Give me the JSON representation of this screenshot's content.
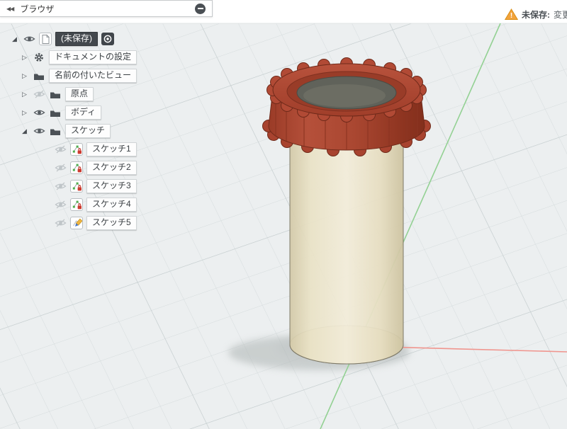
{
  "panel": {
    "title": "ブラウザ"
  },
  "icons": {
    "collapse": "◀◀",
    "expanded": "◢",
    "collapsed": "▷",
    "warning_mark": "!"
  },
  "tree": {
    "document": {
      "label": "(未保存)"
    },
    "items": [
      {
        "label": "ドキュメントの設定",
        "state": "collapsed"
      },
      {
        "label": "名前の付いたビュー",
        "state": "collapsed"
      },
      {
        "label": "原点",
        "state": "collapsed",
        "visible": false
      },
      {
        "label": "ボディ",
        "state": "collapsed",
        "visible": true
      },
      {
        "label": "スケッチ",
        "state": "expanded",
        "visible": true
      }
    ],
    "sketches": [
      {
        "label": "スケッチ1",
        "visible": false
      },
      {
        "label": "スケッチ2",
        "visible": false
      },
      {
        "label": "スケッチ3",
        "visible": false
      },
      {
        "label": "スケッチ4",
        "visible": false
      },
      {
        "label": "スケッチ5",
        "visible": false,
        "editing": true
      }
    ]
  },
  "status": {
    "warning_label": "未保存:",
    "warning_detail": "変更が"
  },
  "colors": {
    "cap_red": "#a8432f",
    "body_cream": "#eee7cd",
    "warning_orange": "#f2a33c",
    "axis_green": "#93d193",
    "axis_red": "#f0958e",
    "selection_dark": "#41464b"
  }
}
